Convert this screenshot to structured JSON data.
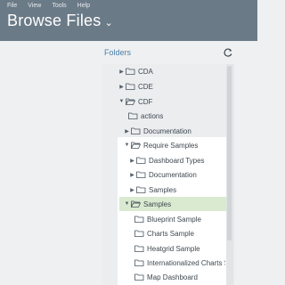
{
  "menubar": [
    "File",
    "View",
    "Tools",
    "Help"
  ],
  "title": "Browse Files",
  "folders_label": "Folders",
  "tree": [
    {
      "label": "CDA",
      "arrow": "right"
    },
    {
      "label": "CDE",
      "arrow": "right"
    },
    {
      "label": "CDF",
      "arrow": "down"
    },
    {
      "label": "actions",
      "arrow": ""
    },
    {
      "label": "Documentation",
      "arrow": "right"
    },
    {
      "label": "Require Samples",
      "arrow": "down"
    },
    {
      "label": "Dashboard Types",
      "arrow": "right"
    },
    {
      "label": "Documentation",
      "arrow": "right"
    },
    {
      "label": "Samples",
      "arrow": "right"
    },
    {
      "label": "Samples",
      "arrow": "down"
    },
    {
      "label": "Blueprint Sample",
      "arrow": ""
    },
    {
      "label": "Charts Sample",
      "arrow": ""
    },
    {
      "label": "Heatgrid Sample",
      "arrow": ""
    },
    {
      "label": "Internationalized Charts S",
      "arrow": ""
    },
    {
      "label": "Map Dashboard",
      "arrow": ""
    }
  ],
  "colors": {
    "header": "#6b7a87",
    "accent": "#4a7fa8",
    "selected": "#d9ead0"
  }
}
